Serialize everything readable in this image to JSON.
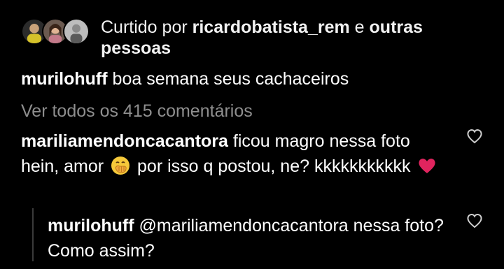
{
  "likes": {
    "prefix": "Curtido por ",
    "user": "ricardobatista_rem",
    "joiner": " e ",
    "others": "outras pessoas"
  },
  "caption": {
    "user": "murilohuff",
    "text": " boa semana seus cachaceiros"
  },
  "view_all": "Ver todos os 415 comentários",
  "comment": {
    "user": "mariliamendoncacantora",
    "text_1": " ficou magro nessa foto hein, amor ",
    "emoji_1": "hand-over-mouth-emoji",
    "text_2": " por isso q postou, ne? kkkkkkkkkkk ",
    "emoji_2": "red-heart-emoji"
  },
  "reply": {
    "user": "murilohuff",
    "mention": "@mariliamendoncacantora",
    "text": " nessa foto? Como assim?"
  },
  "icons": {
    "like": "heart-outline-icon"
  },
  "colors": {
    "background": "#000000",
    "text": "#ffffff",
    "muted": "#8e8e8e",
    "heart": "#e0245e"
  }
}
